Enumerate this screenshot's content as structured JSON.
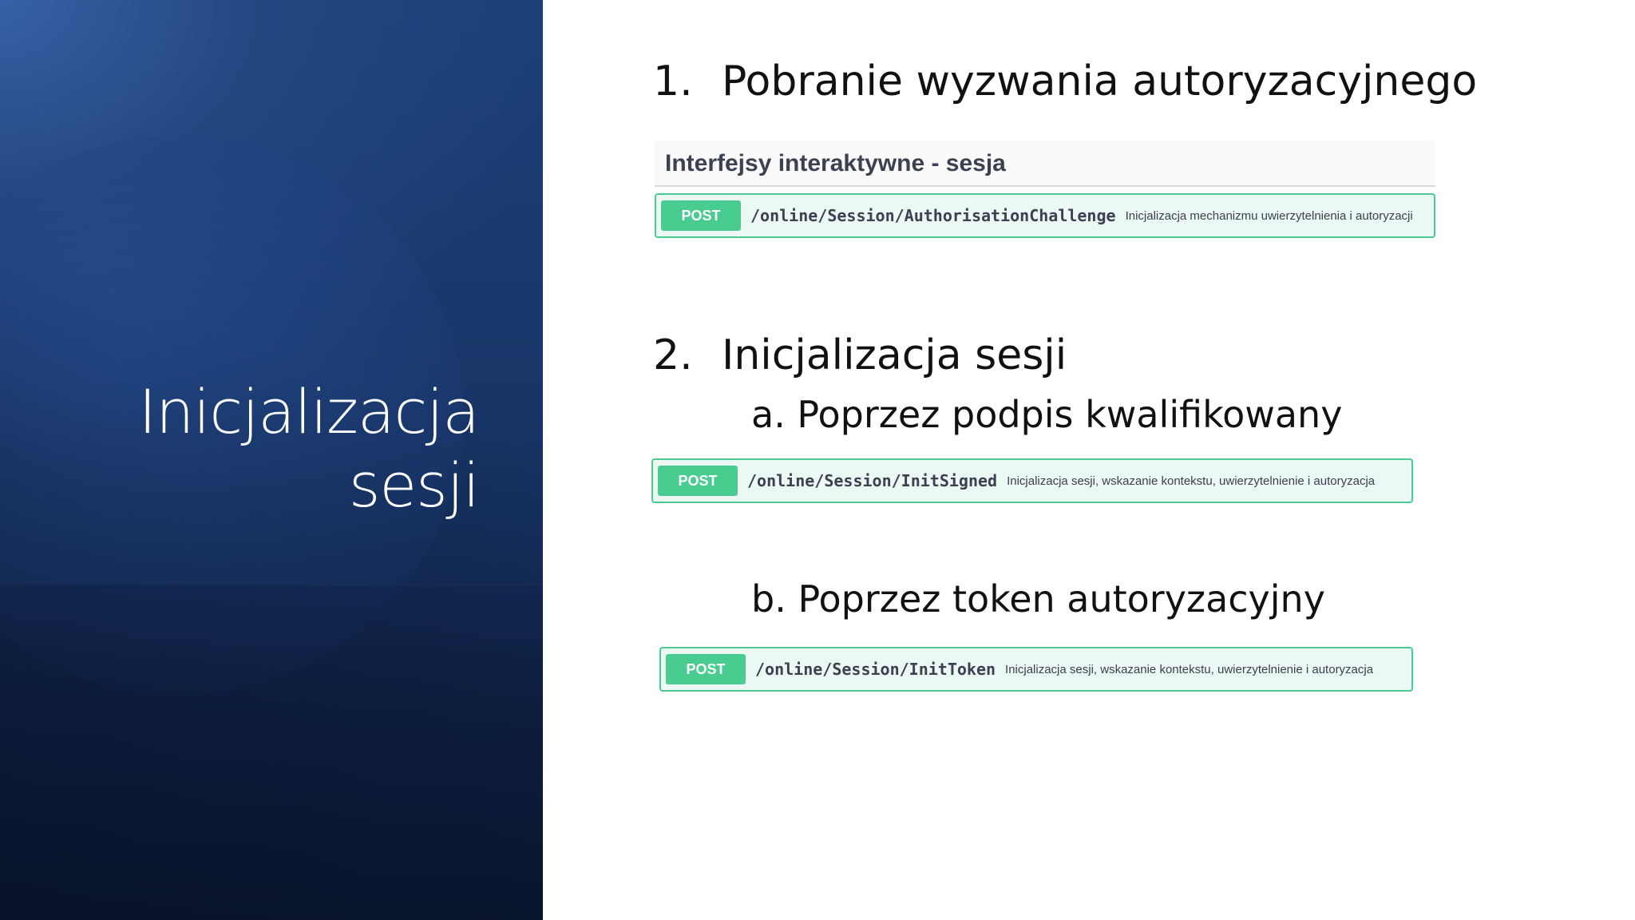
{
  "slide": {
    "title_line1": "Inicjalizacja",
    "title_line2": "sesji"
  },
  "step1": {
    "number": "1.",
    "text": "Pobranie wyzwania autoryzacyjnego"
  },
  "section_header": "Interfejsy interaktywne - sesja",
  "endpoints": [
    {
      "method": "POST",
      "path": "/online/Session/AuthorisationChallenge",
      "summary": "Inicjalizacja mechanizmu uwierzytelnienia i autoryzacji"
    },
    {
      "method": "POST",
      "path": "/online/Session/InitSigned",
      "summary": "Inicjalizacja sesji, wskazanie kontekstu, uwierzytelnienie i autoryzacja"
    },
    {
      "method": "POST",
      "path": "/online/Session/InitToken",
      "summary": "Inicjalizacja sesji, wskazanie kontekstu, uwierzytelnienie i autoryzacja"
    }
  ],
  "step2": {
    "number": "2.",
    "text": "Inicjalizacja sesji",
    "sub_a": "a. Poprzez podpis kwalifikowany",
    "sub_b": "b. Poprzez token autoryzacyjny"
  },
  "colors": {
    "post_green": "#49cc90",
    "post_bg": "#ebf8f3",
    "panel_blue": "#1c3f78"
  }
}
